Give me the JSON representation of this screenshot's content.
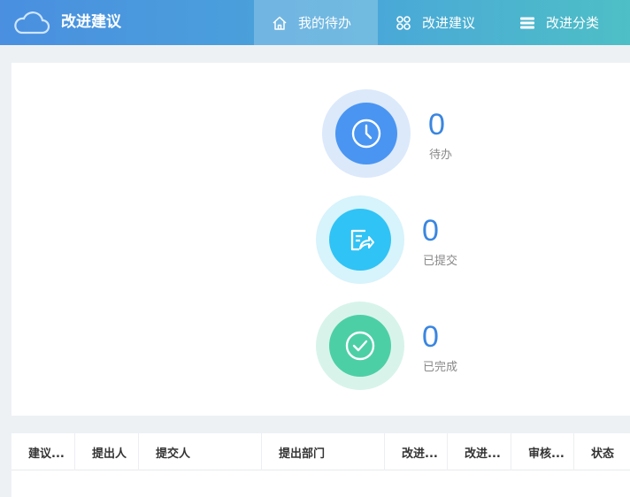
{
  "header": {
    "title": "改进建议",
    "logo_icon": "cloud-icon",
    "tabs": [
      {
        "label": "我的待办",
        "icon": "home-icon",
        "active": true
      },
      {
        "label": "改进建议",
        "icon": "grid-icon",
        "active": false
      },
      {
        "label": "改进分类",
        "icon": "list-icon",
        "active": false
      }
    ]
  },
  "stats": [
    {
      "value": "0",
      "label": "待办",
      "icon": "clock-icon",
      "color": "#4a95f2",
      "halo": "#dbe9fb"
    },
    {
      "value": "0",
      "label": "已提交",
      "icon": "edit-share-icon",
      "color": "#30c3f5",
      "halo": "#d7f3fc"
    },
    {
      "value": "0",
      "label": "已完成",
      "icon": "check-circle-icon",
      "color": "#4dcfa6",
      "halo": "#d8f4ea"
    }
  ],
  "table": {
    "columns": [
      "建议...",
      "提出人",
      "提交人",
      "提出部门",
      "改进...",
      "改进...",
      "审核...",
      "状态"
    ]
  },
  "colors": {
    "accent": "#3a86e0",
    "header_start": "#4a8fe0",
    "header_end": "#4ebfc6"
  }
}
